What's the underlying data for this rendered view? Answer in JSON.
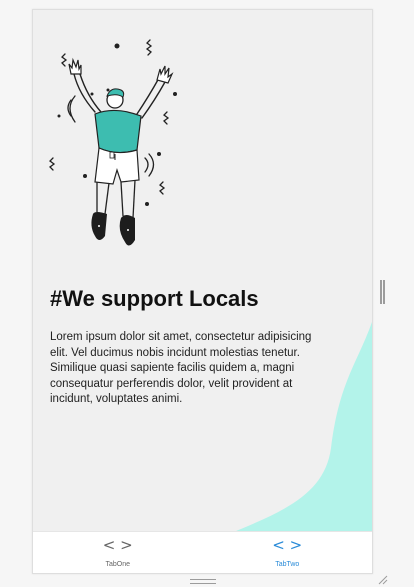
{
  "main": {
    "title": "#We support Locals",
    "body": "Lorem ipsum dolor sit amet, consectetur adipisicing elit. Vel ducimus nobis incidunt molestias tenetur. Similique quasi sapiente facilis quidem a, magni consequatur perferendis dolor, velit provident at incidunt, voluptates animi.",
    "illustration_icon": "jumping-person-illustration"
  },
  "tabs": [
    {
      "label": "TabOne",
      "icon": "code-icon",
      "icon_glyph": "< >",
      "color": "#666666",
      "active": false
    },
    {
      "label": "TabTwo",
      "icon": "code-icon",
      "icon_glyph": "< >",
      "color": "#2a8bd8",
      "active": true
    }
  ],
  "colors": {
    "accent_wave": "#b3f3ea",
    "shirt": "#3dbdb0",
    "background": "#f0f0f0"
  }
}
